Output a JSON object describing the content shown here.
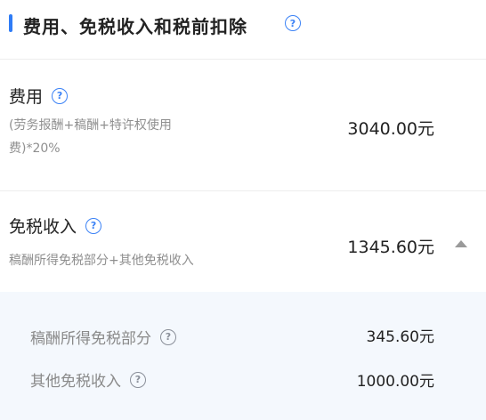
{
  "section": {
    "title": "费用、免税收入和税前扣除",
    "help_icon": "question-circle-icon",
    "accent_color": "#2f7cf6"
  },
  "expenses": {
    "title": "费用",
    "description_line1": "(劳务报酬+稿酬+特许权使用",
    "description_line2": "费)*20%",
    "amount": "3040.00元"
  },
  "tax_free_income": {
    "title": "免税收入",
    "description": "稿酬所得免税部分+其他免税收入",
    "amount": "1345.60元",
    "expanded": true,
    "items": [
      {
        "label": "稿酬所得免税部分",
        "amount": "345.60元"
      },
      {
        "label": "其他免税收入",
        "amount": "1000.00元"
      }
    ]
  }
}
